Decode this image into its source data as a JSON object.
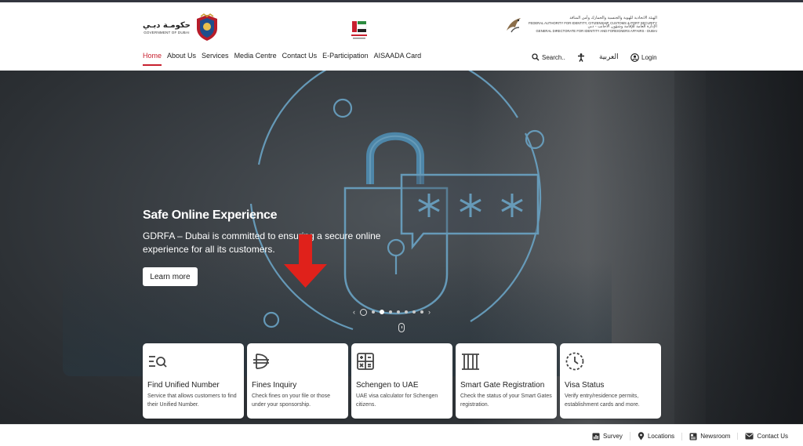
{
  "header": {
    "dubai_logo": {
      "arabic": "حكومـة دبـي",
      "english": "GOVERNMENT OF DUBAI"
    },
    "center_logo": {
      "arabic": "الإمارات"
    },
    "gdrfa_logo": {
      "line1": "الهيئة الاتحادية للهوية والجنسية والجمارك وأمن المنافذ",
      "line2": "FEDERAL AUTHORITY FOR IDENTITY, CITIZENSHIP, CUSTOMS & PORT SECURITY",
      "line3": "الإدارة العامة للإقامة وشؤون الأجانب - دبي",
      "line4": "GENERAL DIRECTORATE FOR IDENTITY AND FOREIGNERS AFFAIRS - DUBAI"
    }
  },
  "nav": {
    "items": [
      {
        "label": "Home",
        "active": true
      },
      {
        "label": "About Us"
      },
      {
        "label": "Services"
      },
      {
        "label": "Media Centre"
      },
      {
        "label": "Contact Us"
      },
      {
        "label": "E-Participation"
      },
      {
        "label": "AISAADA Card"
      }
    ],
    "search_label": "Search..",
    "language_label": "العربية",
    "login_label": "Login"
  },
  "hero": {
    "title": "Safe Online Experience",
    "description": "GDRFA – Dubai is committed to ensuring a secure online experience for all its customers.",
    "cta_label": "Learn more",
    "slide_count": 7,
    "active_slide": 1
  },
  "cards": [
    {
      "icon": "search-list-icon",
      "title": "Find Unified Number",
      "desc": "Service that allows customers to find their Unified Number."
    },
    {
      "icon": "dirham-icon",
      "title": "Fines Inquiry",
      "desc": "Check fines on your file or those under your sponsorship."
    },
    {
      "icon": "calculator-icon",
      "title": "Schengen to UAE",
      "desc": "UAE visa calculator for Schengen citizens."
    },
    {
      "icon": "gate-icon",
      "title": "Smart Gate Registration",
      "desc": "Check the status of your Smart Gates registration."
    },
    {
      "icon": "clock-icon",
      "title": "Visa Status",
      "desc": "Verify entry/residence permits, establishment cards and more."
    }
  ],
  "bottom_links": [
    {
      "icon": "chart-icon",
      "label": "Survey"
    },
    {
      "icon": "location-pin-icon",
      "label": "Locations"
    },
    {
      "icon": "newspaper-icon",
      "label": "Newsroom"
    },
    {
      "icon": "mail-icon",
      "label": "Contact Us"
    }
  ],
  "colors": {
    "accent": "#c8202f",
    "annotation_arrow": "#e0211b",
    "hero_line": "#6aa3c4"
  }
}
